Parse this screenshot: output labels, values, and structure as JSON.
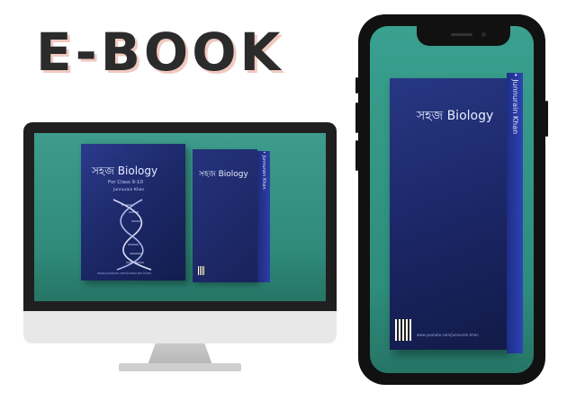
{
  "headline": "E-BOOK",
  "book": {
    "title": "সহজ Biology",
    "subtitle": "For Class 9-10",
    "author_front": "Junnurain Khan",
    "spine_title": "সহজ Biology",
    "spine_author": "• Junnurain Khan",
    "footer": "www.youtube.com/junnurain-khan"
  },
  "colors": {
    "background": "#ffffff",
    "teal_backdrop": "#2f8a7a",
    "book_cover": "#1d2a6b",
    "device_frame": "#111111"
  },
  "icons": {
    "dna": "dna-helix-icon",
    "qr": "qr-code-icon"
  }
}
